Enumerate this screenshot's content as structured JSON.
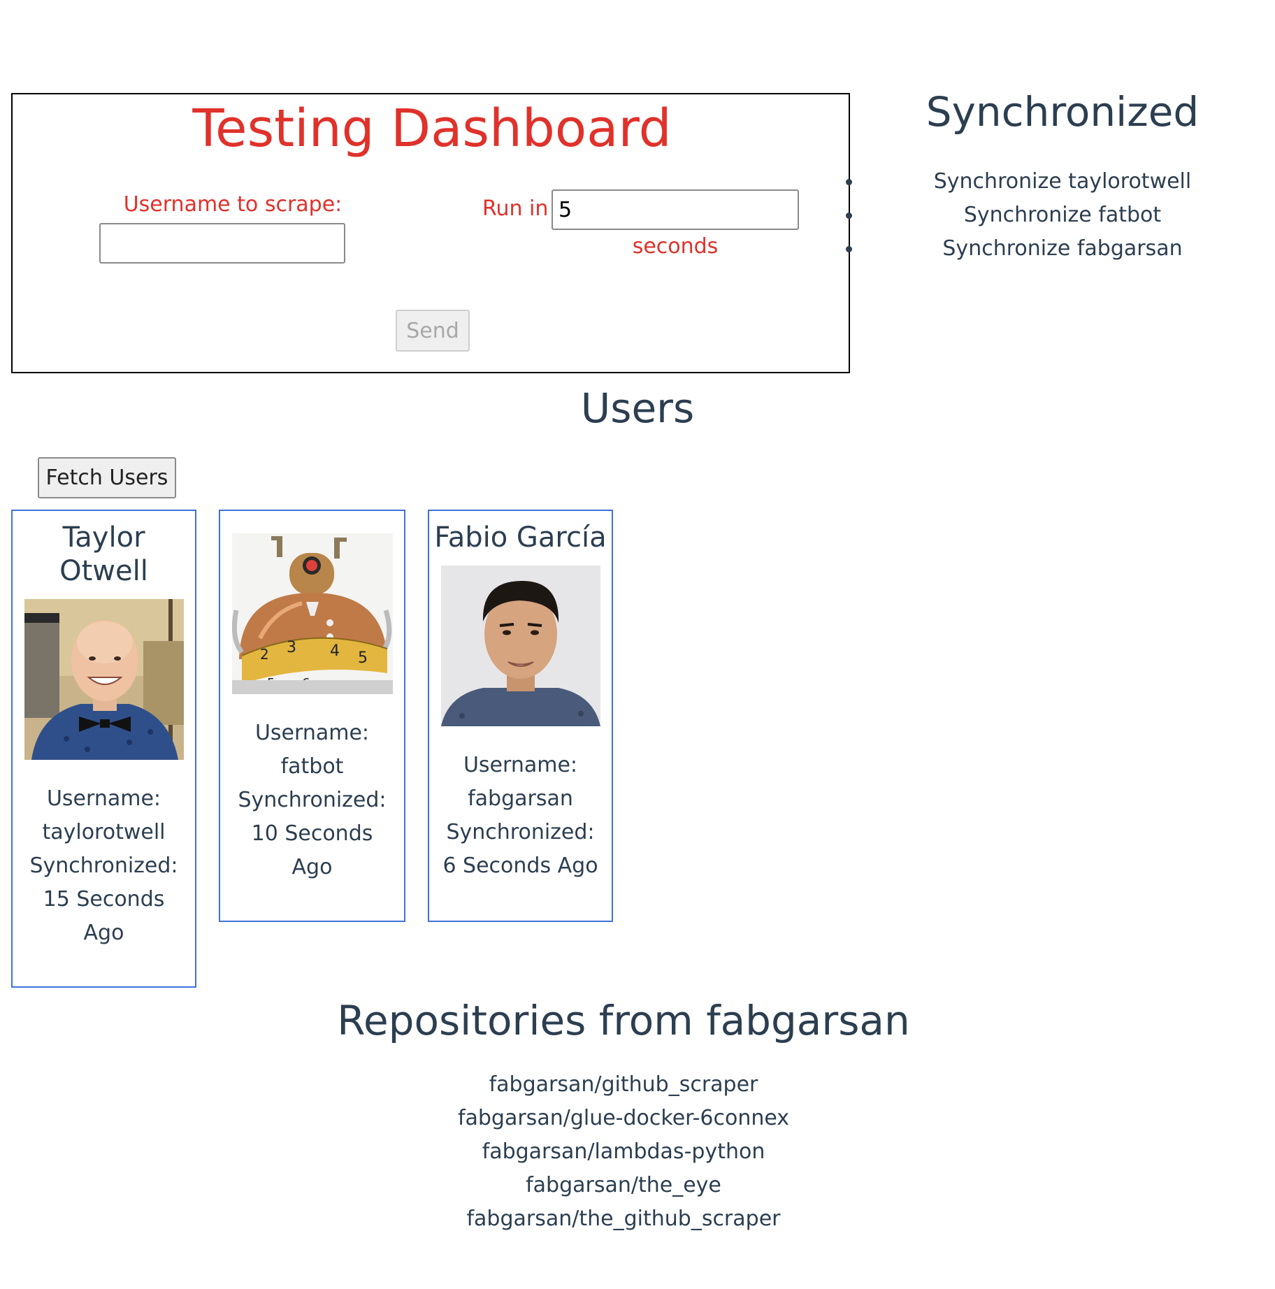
{
  "dashboard": {
    "title": "Testing Dashboard",
    "username_label": "Username to scrape:",
    "username_value": "",
    "run_in_label": "Run in",
    "run_in_value": "5",
    "seconds_label": "seconds",
    "send_label": "Send"
  },
  "synchronized": {
    "title": "Synchronized",
    "items": [
      "Synchronize taylorotwell",
      "Synchronize fatbot",
      "Synchronize fabgarsan"
    ]
  },
  "users": {
    "title": "Users",
    "fetch_label": "Fetch Users",
    "cards": [
      {
        "name": "Taylor Otwell",
        "username_label": "Username:",
        "username": "taylorotwell",
        "synchronized_label": "Synchronized:",
        "synchronized": "15 Seconds Ago"
      },
      {
        "name": "",
        "username_label": "Username:",
        "username": "fatbot",
        "synchronized_label": "Synchronized:",
        "synchronized": "10 Seconds Ago"
      },
      {
        "name": "Fabio García",
        "username_label": "Username:",
        "username": "fabgarsan",
        "synchronized_label": "Synchronized:",
        "synchronized": "6 Seconds Ago"
      }
    ]
  },
  "repositories": {
    "title": "Repositories from fabgarsan",
    "items": [
      "fabgarsan/github_scraper",
      "fabgarsan/glue-docker-6connex",
      "fabgarsan/lambdas-python",
      "fabgarsan/the_eye",
      "fabgarsan/the_github_scraper"
    ]
  },
  "colors": {
    "accent_red": "#e0312b",
    "text": "#2c3e50",
    "card_border": "#3f72d8"
  }
}
